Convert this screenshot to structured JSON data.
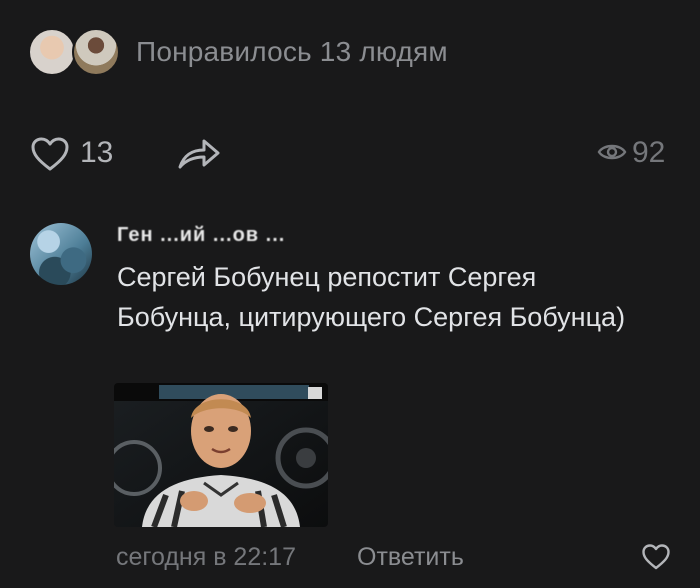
{
  "likes_summary": {
    "text": "Понравилось 13 людям",
    "avatars": [
      "liker-avatar-1",
      "liker-avatar-2"
    ]
  },
  "actions": {
    "like_icon": "heart-icon",
    "likes_count": "13",
    "share_icon": "share-icon",
    "views_icon": "eye-icon",
    "views_count": "92"
  },
  "comment": {
    "author": "Ген ...ий ...ов ...",
    "text": "Сергей Бобунец репостит Сергея Бобунца, цитирующего Сергея Бобунца)",
    "time": "сегодня в 22:17",
    "reply_label": "Ответить",
    "like_icon": "heart-icon",
    "attachment": "photo"
  },
  "colors": {
    "background": "#19191a",
    "text_primary": "#e1e3e6",
    "text_secondary": "#75777b"
  }
}
